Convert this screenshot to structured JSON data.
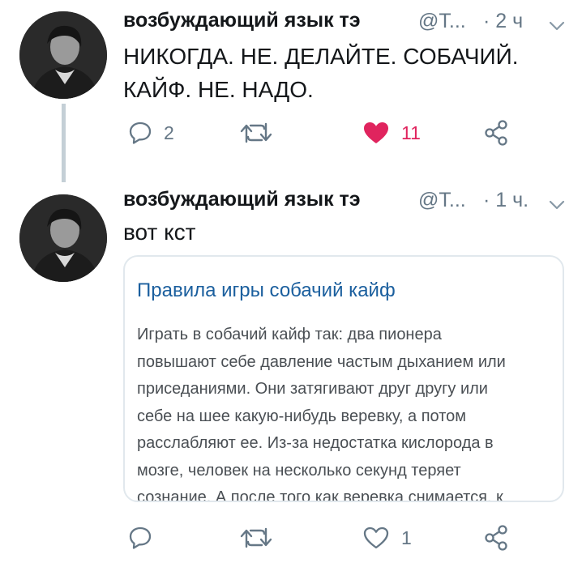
{
  "tweets": [
    {
      "author": "возбуждающий язык тэ",
      "handle": "@T...",
      "time": "· 2 ч",
      "text_lines": [
        "НИКОГДА. НЕ. ДЕЛАЙТЕ. СОБАЧИЙ.",
        "КАЙФ. НЕ. НАДО."
      ],
      "reply_count": "2",
      "retweet_count": "",
      "like_count": "11",
      "liked": true
    },
    {
      "author": "возбуждающий язык тэ",
      "handle": "@T...",
      "time": "· 1 ч.",
      "text_lines": [
        "вот кст"
      ],
      "reply_count": "",
      "retweet_count": "",
      "like_count": "1",
      "liked": false,
      "card": {
        "title": "Правила игры собачий кайф",
        "description_lines": [
          "Играть в собачий кайф так: два пионера",
          "повышают себе давление частым дыханием или",
          "приседаниями. Они затягивают друг другу или",
          "себе на шее какую-нибудь веревку, а потом",
          "расслабляют ее. Из-за недостатка кислорода в",
          "мозге, человек на несколько секунд теряет",
          "сознание. А после того как веревка снимается, к"
        ]
      }
    }
  ],
  "icons": {
    "reply": "reply-icon",
    "retweet": "retweet-icon",
    "like": "heart-icon",
    "share": "share-icon",
    "more": "chevron-down-icon"
  },
  "colors": {
    "like_active": "#e0245e",
    "secondary_text": "#657786",
    "card_link": "#1b5f9e",
    "thread_line": "#c4cfd6"
  }
}
